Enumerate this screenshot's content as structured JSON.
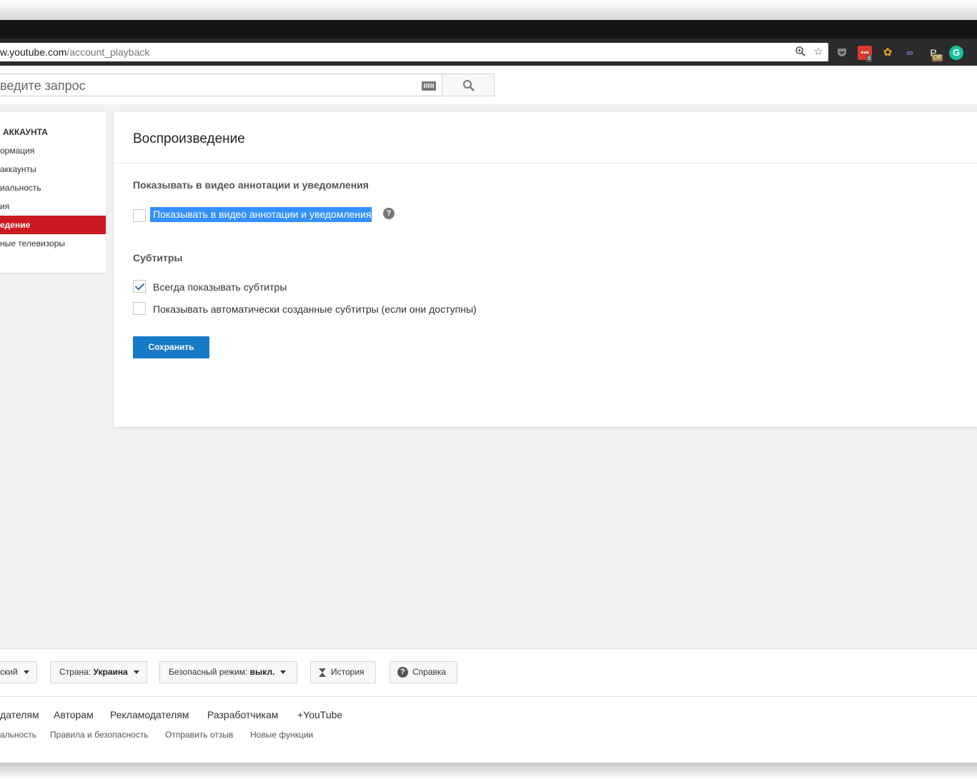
{
  "browser": {
    "url_host": "w.youtube.com",
    "url_path": "/account_playback",
    "extensions": [
      {
        "icon": "pocket-icon",
        "color": "#2b2b2b"
      },
      {
        "icon": "todoist-icon",
        "color": "#db3a2a",
        "badge": "6"
      },
      {
        "icon": "paw-icon",
        "color": "#2b2b2b"
      },
      {
        "icon": "mask-icon",
        "color": "#2b2b2b"
      },
      {
        "icon": "proxy-icon",
        "color": "#2b2b2b",
        "badge": "Off"
      },
      {
        "icon": "grammarly-icon",
        "color": "#15c39a"
      }
    ]
  },
  "header": {
    "search_placeholder": "ведите запрос"
  },
  "sidebar": {
    "heading": "И АККАУНТА",
    "items": [
      {
        "label": "ормация"
      },
      {
        "label": "аккаунты"
      },
      {
        "label": "иальность"
      },
      {
        "label": "ия"
      },
      {
        "label": "едение",
        "active": true
      },
      {
        "label": "ные телевизоры"
      }
    ]
  },
  "main": {
    "title": "Воспроизведение",
    "annotations": {
      "heading": "Показывать в видео аннотации и уведомления",
      "checkbox_label": "Показывать в видео аннотации и уведомления",
      "checked": false,
      "help": "?"
    },
    "subtitles": {
      "heading": "Субтитры",
      "options": [
        {
          "label": "Всегда показывать субтитры",
          "checked": true
        },
        {
          "label": "Показывать автоматически созданные субтитры (если они доступны)",
          "checked": false
        }
      ]
    },
    "save_label": "Сохранить"
  },
  "footer": {
    "language": "ский",
    "country_prefix": "Страна:",
    "country_value": "Украина",
    "safe_prefix": "Безопасный режим:",
    "safe_value": "выкл.",
    "history": "История",
    "help": "Справка",
    "links_primary": [
      "дателям",
      "Авторам",
      "Рекламодателям",
      "Разработчикам",
      "+YouTube"
    ],
    "links_secondary": [
      "альность",
      "Правила и безопасность",
      "Отправить отзыв",
      "Новые функции"
    ]
  },
  "colors": {
    "accent_red": "#cc181e",
    "save_blue": "#167ac6",
    "selection_blue": "#3390ff"
  }
}
